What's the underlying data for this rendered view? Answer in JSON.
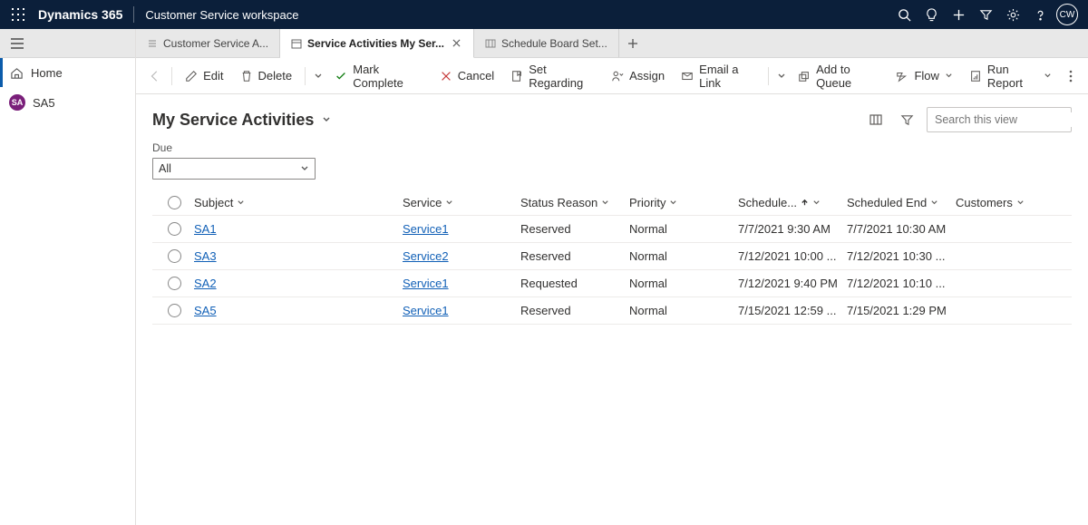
{
  "topbar": {
    "brand": "Dynamics 365",
    "app": "Customer Service workspace",
    "avatar": "CW"
  },
  "sidebar": {
    "items": [
      {
        "label": "Home",
        "icon": "home"
      },
      {
        "label": "SA5",
        "icon": "badge",
        "badge": "SA"
      }
    ]
  },
  "tabs": [
    {
      "label": "Customer Service A...",
      "active": false
    },
    {
      "label": "Service Activities My Ser...",
      "active": true,
      "closeable": true
    },
    {
      "label": "Schedule Board Set...",
      "active": false
    }
  ],
  "commands": {
    "edit": "Edit",
    "delete": "Delete",
    "mark_complete": "Mark Complete",
    "cancel": "Cancel",
    "set_regarding": "Set Regarding",
    "assign": "Assign",
    "email_link": "Email a Link",
    "add_to_queue": "Add to Queue",
    "flow": "Flow",
    "run_report": "Run Report"
  },
  "view": {
    "title": "My Service Activities",
    "search_placeholder": "Search this view",
    "filter_label": "Due",
    "filter_value": "All"
  },
  "columns": {
    "subject": "Subject",
    "service": "Service",
    "status_reason": "Status Reason",
    "priority": "Priority",
    "scheduled_start": "Schedule...",
    "scheduled_end": "Scheduled End",
    "customers": "Customers"
  },
  "rows": [
    {
      "subject": "SA1",
      "service": "Service1",
      "status": "Reserved",
      "priority": "Normal",
      "start": "7/7/2021 9:30 AM",
      "end": "7/7/2021 10:30 AM",
      "customers": ""
    },
    {
      "subject": "SA3",
      "service": "Service2",
      "status": "Reserved",
      "priority": "Normal",
      "start": "7/12/2021 10:00 ...",
      "end": "7/12/2021 10:30 ...",
      "customers": ""
    },
    {
      "subject": "SA2",
      "service": "Service1",
      "status": "Requested",
      "priority": "Normal",
      "start": "7/12/2021 9:40 PM",
      "end": "7/12/2021 10:10 ...",
      "customers": ""
    },
    {
      "subject": "SA5",
      "service": "Service1",
      "status": "Reserved",
      "priority": "Normal",
      "start": "7/15/2021 12:59 ...",
      "end": "7/15/2021 1:29 PM",
      "customers": ""
    }
  ]
}
